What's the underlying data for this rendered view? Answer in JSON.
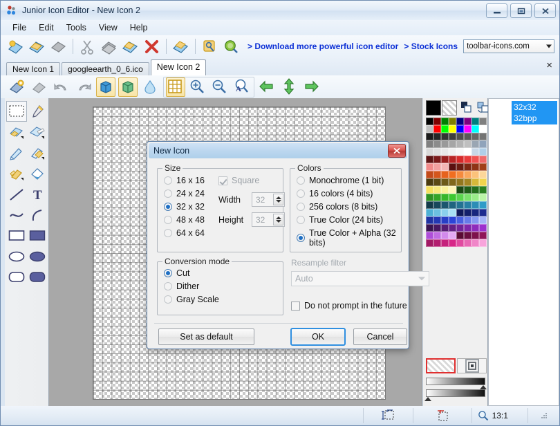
{
  "window": {
    "title": "Junior Icon Editor - New Icon 2",
    "icon": "app-icon",
    "controls": {
      "minimize": "minimize-button",
      "restore": "restore-button",
      "close": "close-button"
    }
  },
  "menu": {
    "items": [
      {
        "label": "File"
      },
      {
        "label": "Edit"
      },
      {
        "label": "Tools"
      },
      {
        "label": "View"
      },
      {
        "label": "Help"
      }
    ]
  },
  "toolbar_main": {
    "icons": [
      {
        "name": "new-icon",
        "glyph": "new"
      },
      {
        "name": "open-icon",
        "glyph": "open"
      },
      {
        "name": "save-icon",
        "glyph": "save"
      },
      {
        "name": "cut-icon",
        "glyph": "cut"
      },
      {
        "name": "copy-icon",
        "glyph": "copy"
      },
      {
        "name": "paste-icon",
        "glyph": "paste"
      },
      {
        "name": "delete-icon",
        "glyph": "delete"
      },
      {
        "name": "import-icon",
        "glyph": "import"
      },
      {
        "name": "properties-icon",
        "glyph": "props"
      },
      {
        "name": "preview-icon",
        "glyph": "preview"
      }
    ],
    "link_download": "> Download more powerful icon editor",
    "link_stock": "> Stock Icons",
    "combo_value": "toolbar-icons.com"
  },
  "tabs": {
    "items": [
      {
        "label": "New Icon 1",
        "active": false
      },
      {
        "label": "googleearth_0_6.ico",
        "active": false
      },
      {
        "label": "New Icon 2",
        "active": true
      }
    ],
    "close_label": "×"
  },
  "toolbar_edit": {
    "icons": [
      {
        "name": "add-image-icon",
        "selected": false
      },
      {
        "name": "delete-image-icon",
        "selected": false
      },
      {
        "name": "undo-icon",
        "selected": false
      },
      {
        "name": "redo-icon",
        "selected": false
      },
      {
        "name": "image-3d-blue-icon",
        "selected": true
      },
      {
        "name": "image-3d-green-icon",
        "selected": true
      },
      {
        "name": "opacity-drop-icon",
        "selected": false
      },
      {
        "name": "grid-icon",
        "selected": true
      },
      {
        "name": "zoom-in-icon",
        "selected": false
      },
      {
        "name": "zoom-out-icon",
        "selected": false
      },
      {
        "name": "actual-size-icon",
        "selected": false
      },
      {
        "name": "nav-left-icon",
        "selected": false
      },
      {
        "name": "nav-updown-icon",
        "selected": false
      },
      {
        "name": "nav-right-icon",
        "selected": false
      }
    ]
  },
  "tools": {
    "items": [
      {
        "name": "select-rectangle-tool",
        "active": true
      },
      {
        "name": "color-picker-tool",
        "active": false
      },
      {
        "name": "eraser-tool",
        "active": false
      },
      {
        "name": "eraser-large-tool",
        "active": false
      },
      {
        "name": "pencil-tool",
        "active": false
      },
      {
        "name": "brush-tool",
        "active": false
      },
      {
        "name": "airbrush-tool",
        "active": false
      },
      {
        "name": "fill-tool",
        "active": false
      },
      {
        "name": "line-tool",
        "active": false
      },
      {
        "name": "text-tool",
        "active": false
      },
      {
        "name": "curve-tool",
        "active": false
      },
      {
        "name": "arc-tool",
        "active": false
      },
      {
        "name": "rectangle-outline-tool",
        "active": false
      },
      {
        "name": "rectangle-filled-tool",
        "active": false
      },
      {
        "name": "ellipse-outline-tool",
        "active": false
      },
      {
        "name": "ellipse-filled-tool",
        "active": false
      },
      {
        "name": "rounded-rect-outline-tool",
        "active": false
      },
      {
        "name": "rounded-rect-filled-tool",
        "active": false
      }
    ]
  },
  "palette": {
    "current_color": "#000000",
    "alt_color": "transparent",
    "swap_icon": "swap-colors-icon",
    "reset_icon": "reset-colors-icon",
    "transparent_label": "transparent-swatch",
    "target_label": "target-swatch",
    "rows": [
      [
        "#000000",
        "#7f0000",
        "#007f00",
        "#7f7f00",
        "#00007f",
        "#7f007f",
        "#007f7f",
        "#7f7f7f"
      ],
      [
        "#c0c0c0",
        "#ff0000",
        "#00ff00",
        "#ffff00",
        "#0000ff",
        "#ff00ff",
        "#00ffff",
        "#ffffff"
      ],
      [
        "#1a1a1a",
        "#262626",
        "#333333",
        "#3d3d3d",
        "#4d4d4d",
        "#595959",
        "#666666",
        "#737373"
      ],
      [
        "#808080",
        "#8c8c8c",
        "#999999",
        "#a6a6a6",
        "#b3b3b3",
        "#bfbfbf",
        "#9aa6b3",
        "#8fa3bb"
      ],
      [
        "#d9d9d9",
        "#e0e0e0",
        "#e8e8e8",
        "#f0f0f0",
        "#f7f7f7",
        "#ffffff",
        "#c8d8e8",
        "#b0cfe8"
      ],
      [
        "#5c1414",
        "#7a1a1a",
        "#991f1f",
        "#b82424",
        "#d62a2a",
        "#e83a3a",
        "#f05252",
        "#f06a6a"
      ],
      [
        "#f08a8a",
        "#f2a0a0",
        "#f4b5b5",
        "#5a1010",
        "#6b1c12",
        "#7d2814",
        "#8f3416",
        "#a14018"
      ],
      [
        "#c24a1a",
        "#d4561c",
        "#e6621e",
        "#f06e20",
        "#f58a3e",
        "#f9a65c",
        "#fbc27a",
        "#fcd79a"
      ],
      [
        "#4a3b10",
        "#5c4a14",
        "#6e5918",
        "#80681c",
        "#927720",
        "#a48624",
        "#d6b83a",
        "#f0d44e"
      ],
      [
        "#f5e060",
        "#f8e87c",
        "#fbf09a",
        "#fdf5b8",
        "#1a4a14",
        "#1f5c18",
        "#246e1c",
        "#298020"
      ],
      [
        "#2e9224",
        "#33a428",
        "#38b62c",
        "#3dc830",
        "#5ad44e",
        "#7ae06c",
        "#9aec8a",
        "#baf4a8"
      ],
      [
        "#143a4a",
        "#18485c",
        "#1c566e",
        "#206480",
        "#247292",
        "#2880a4",
        "#2c8eb6",
        "#309cc8"
      ],
      [
        "#4eb0d4",
        "#6cc0e0",
        "#8ad0ec",
        "#a8e0f4",
        "#101a5a",
        "#14206b",
        "#18267d",
        "#1c2c8f"
      ],
      [
        "#2032a1",
        "#2438b3",
        "#283ec5",
        "#2c44d7",
        "#4a60e0",
        "#687ce8",
        "#8698f0",
        "#a4b4f8"
      ],
      [
        "#3a1450",
        "#481862",
        "#561c74",
        "#642086",
        "#722498",
        "#8028aa",
        "#8e2cbc",
        "#9c30ce"
      ],
      [
        "#ae4ed8",
        "#c06ce2",
        "#d28aec",
        "#e4a8f4",
        "#5a0a34",
        "#6b0e40",
        "#7d124c",
        "#8f1658"
      ],
      [
        "#a11a64",
        "#b31e70",
        "#c5227c",
        "#d72688",
        "#e04aa0",
        "#e868b4",
        "#f086c8",
        "#f8a4dc"
      ]
    ]
  },
  "images_panel": {
    "items": [
      {
        "size": "32x32",
        "depth": "32bpp",
        "selected": true
      }
    ]
  },
  "statusbar": {
    "segments": [
      {
        "name": "position-indicator",
        "text": ""
      },
      {
        "name": "size-indicator",
        "text": ""
      },
      {
        "name": "selection-indicator",
        "text": ""
      },
      {
        "name": "zoom-indicator",
        "text": "13:1"
      },
      {
        "name": "resize-grip",
        "text": ""
      }
    ],
    "zoom_label": "13:1"
  },
  "dialog": {
    "title": "New Icon",
    "close_label": "✕",
    "size_group": {
      "label": "Size",
      "options": [
        {
          "label": "16 x 16",
          "selected": false
        },
        {
          "label": "24 x 24",
          "selected": false
        },
        {
          "label": "32 x 32",
          "selected": true
        },
        {
          "label": "48 x 48",
          "selected": false
        },
        {
          "label": "64 x 64",
          "selected": false
        }
      ],
      "square_label": "Square",
      "square_checked": true,
      "width_label": "Width",
      "width_value": "32",
      "height_label": "Height",
      "height_value": "32"
    },
    "colors_group": {
      "label": "Colors",
      "options": [
        {
          "label": "Monochrome (1 bit)",
          "selected": false
        },
        {
          "label": "16 colors (4 bits)",
          "selected": false
        },
        {
          "label": "256 colors (8 bits)",
          "selected": false
        },
        {
          "label": "True Color (24 bits)",
          "selected": false
        },
        {
          "label": "True Color + Alpha (32 bits)",
          "selected": true
        }
      ]
    },
    "conversion_group": {
      "label": "Conversion mode",
      "options": [
        {
          "label": "Cut",
          "selected": true
        },
        {
          "label": "Dither",
          "selected": false
        },
        {
          "label": "Gray Scale",
          "selected": false
        }
      ]
    },
    "resample": {
      "label": "Resample filter",
      "value": "Auto",
      "disabled": true
    },
    "do_not_prompt": {
      "label": "Do not prompt in the future",
      "checked": false
    },
    "buttons": {
      "set_default": "Set as default",
      "ok": "OK",
      "cancel": "Cancel"
    }
  }
}
